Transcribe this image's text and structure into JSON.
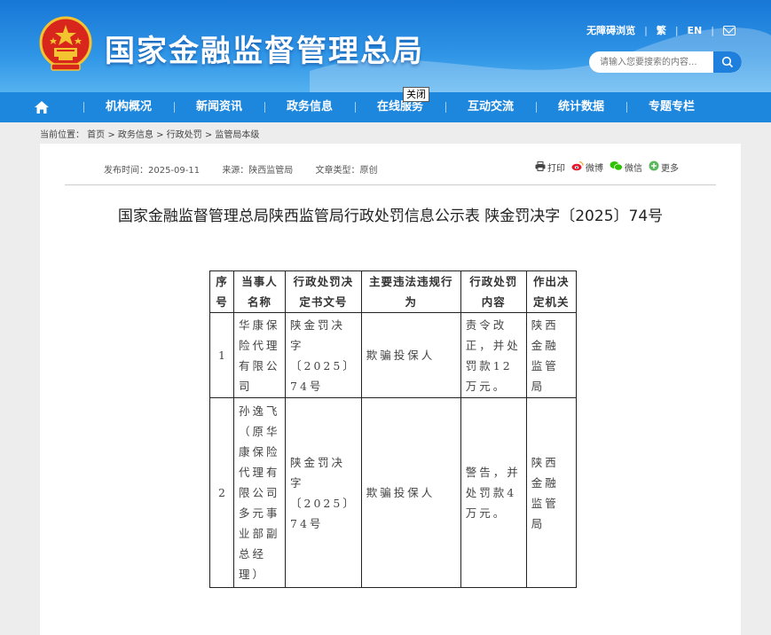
{
  "header": {
    "site_title": "国家金融监督管理总局",
    "top_links": [
      "无障碍浏览",
      "繁",
      "EN"
    ],
    "search_placeholder": "请输入您要搜索的内容..."
  },
  "nav": {
    "items": [
      "机构概况",
      "新闻资讯",
      "政务信息",
      "在线服务",
      "互动交流",
      "统计数据",
      "专题专栏"
    ],
    "tooltip": "关闭"
  },
  "breadcrumb": "当前位置：  首页 > 政务信息 > 行政处罚 > 监管局本级",
  "article": {
    "publish_time": "发布时间：2025-09-11",
    "source": "来源：陕西监管局",
    "doc_type": "文章类型：原创",
    "share": [
      "打印",
      "微博",
      "微信",
      "更多"
    ],
    "title": "国家金融监督管理总局陕西监管局行政处罚信息公示表 陕金罚决字〔2025〕74号"
  },
  "table": {
    "headers": [
      "序号",
      "当事人名称",
      "行政处罚决定书文号",
      "主要违法违规行为",
      "行政处罚内容",
      "作出决定机关"
    ],
    "rows": [
      [
        "1",
        "华康保险代理有限公司",
        "陕金罚决字〔2025〕74号",
        "欺骗投保人",
        "责令改正，并处罚款12万元。",
        "陕西金融监管局"
      ],
      [
        "2",
        "孙逸飞（原华康保险代理有限公司多元事业部副总经理）",
        "陕金罚决字〔2025〕74号",
        "欺骗投保人",
        "警告，并处罚款4万元。",
        "陕西金融监管局"
      ]
    ]
  },
  "colors": {
    "header_blue": "#1877d6",
    "nav_blue": "#1d86dd",
    "page_bg": "#ededed"
  }
}
